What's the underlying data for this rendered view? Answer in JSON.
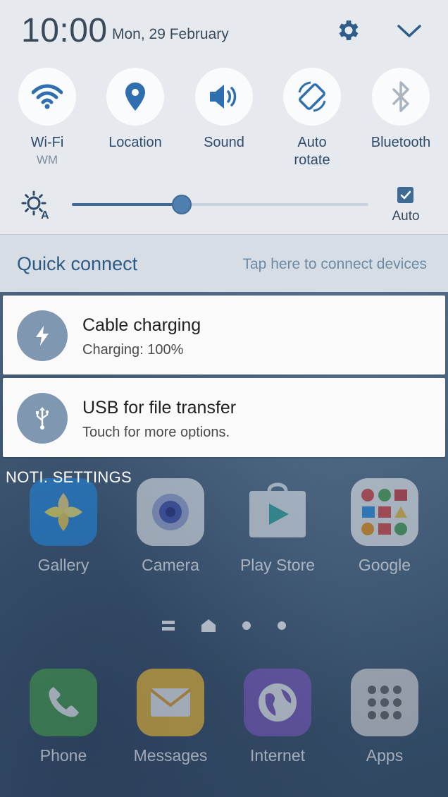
{
  "status": {
    "time": "10:00",
    "date": "Mon, 29 February"
  },
  "header_icons": {
    "settings": "gear-icon",
    "expand": "chevron-down-icon"
  },
  "toggles": [
    {
      "label": "Wi-Fi",
      "sublabel": "WM",
      "icon": "wifi-icon",
      "state": "on"
    },
    {
      "label": "Location",
      "sublabel": "",
      "icon": "location-pin-icon",
      "state": "on"
    },
    {
      "label": "Sound",
      "sublabel": "",
      "icon": "speaker-icon",
      "state": "on"
    },
    {
      "label": "Auto rotate",
      "label_line1": "Auto",
      "label_line2": "rotate",
      "icon": "auto-rotate-icon",
      "state": "on"
    },
    {
      "label": "Bluetooth",
      "sublabel": "",
      "icon": "bluetooth-icon",
      "state": "off"
    }
  ],
  "brightness": {
    "level": 0.37,
    "auto_checked": true,
    "auto_label": "Auto"
  },
  "quick_connect": {
    "title": "Quick connect",
    "hint": "Tap here to connect devices"
  },
  "notifications": [
    {
      "title": "Cable charging",
      "body": "Charging: 100%",
      "icon": "lightning-bolt-icon"
    },
    {
      "title": "USB for file transfer",
      "body": "Touch for more options.",
      "icon": "usb-icon"
    }
  ],
  "noti_settings_label": "NOTI. SETTINGS",
  "home_apps_row1": [
    "Gallery",
    "Camera",
    "Play Store",
    "Google"
  ],
  "home_apps_row2": [
    "Phone",
    "Messages",
    "Internet",
    "Apps"
  ],
  "colors": {
    "panel_bg": "#e6eaef",
    "accent": "#3f6a94",
    "quick_connect_title": "#2e5a86"
  }
}
